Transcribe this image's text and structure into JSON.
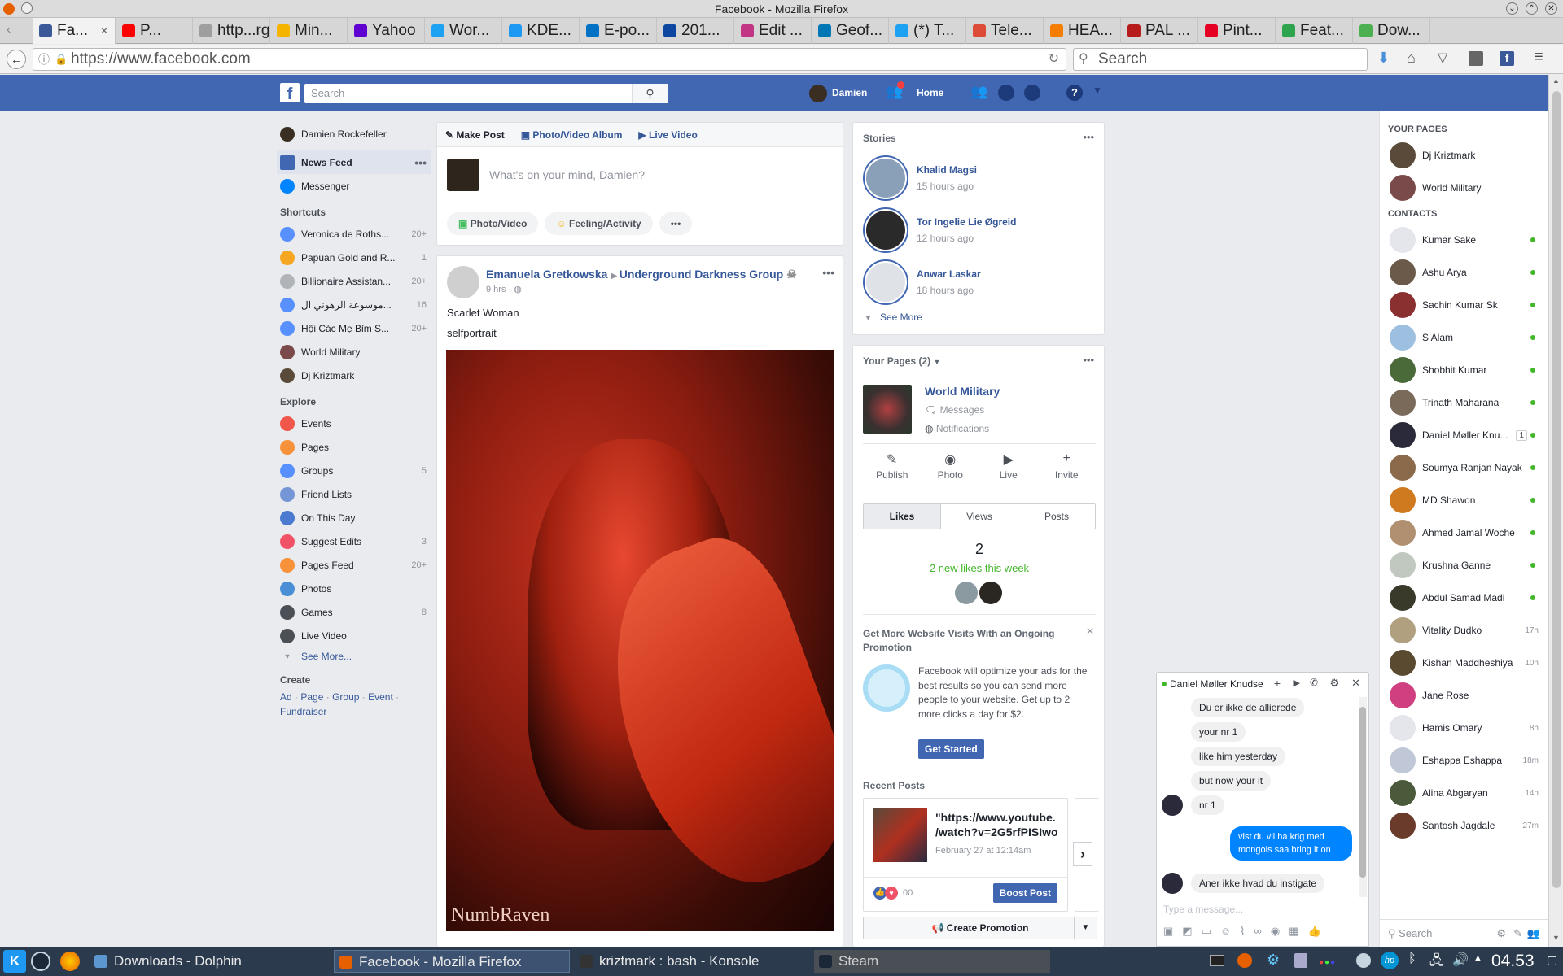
{
  "window": {
    "title": "Facebook - Mozilla Firefox"
  },
  "tabs": [
    {
      "label": "Fa...",
      "color": "#3b5998"
    },
    {
      "label": "P...",
      "color": "#ff0000"
    },
    {
      "label": "http...rg/",
      "color": "#9e9e9e"
    },
    {
      "label": "Min...",
      "color": "#f4b400"
    },
    {
      "label": "Yahoo",
      "color": "#5f01d1"
    },
    {
      "label": "Wor...",
      "color": "#1da1f2"
    },
    {
      "label": "KDE...",
      "color": "#1d99f3"
    },
    {
      "label": "E-po...",
      "color": "#0072c6"
    },
    {
      "label": "201...",
      "color": "#0d47a1"
    },
    {
      "label": "Edit ...",
      "color": "#c13584"
    },
    {
      "label": "Geof...",
      "color": "#0077b5"
    },
    {
      "label": "(*) T...",
      "color": "#1da1f2"
    },
    {
      "label": "Tele...",
      "color": "#dd4b39"
    },
    {
      "label": "HEA...",
      "color": "#f57d00"
    },
    {
      "label": "PAL ...",
      "color": "#b71c1c"
    },
    {
      "label": "Pint...",
      "color": "#e60023"
    },
    {
      "label": "Feat...",
      "color": "#2ea44f"
    },
    {
      "label": "Dow...",
      "color": "#4caf50"
    }
  ],
  "navbar": {
    "url": "https://www.facebook.com",
    "search_placeholder": "Search"
  },
  "fb_header": {
    "search_placeholder": "Search",
    "user_name": "Damien",
    "home_label": "Home"
  },
  "left_nav": {
    "profile_name": "Damien Rockefeller",
    "news_feed": "News Feed",
    "messenger": "Messenger",
    "shortcuts_heading": "Shortcuts",
    "shortcuts": [
      {
        "label": "Veronica de Roths...",
        "count": "20+",
        "color": "#5890ff"
      },
      {
        "label": "Papuan Gold and R...",
        "count": "1",
        "color": "#f5a623"
      },
      {
        "label": "Billionaire Assistan...",
        "count": "20+",
        "color": "#b0b3b8"
      },
      {
        "label": "موسوعة الرهوني ال...",
        "count": "16",
        "color": "#5890ff"
      },
      {
        "label": "Hội Các Mẹ Bỉm S...",
        "count": "20+",
        "color": "#5890ff"
      },
      {
        "label": "World Military",
        "count": "",
        "color": "#7a4a4a"
      },
      {
        "label": "Dj Kriztmark",
        "count": "",
        "color": "#5a4a3a"
      }
    ],
    "explore_heading": "Explore",
    "explore": [
      {
        "label": "Events",
        "count": "",
        "color": "#f0564a"
      },
      {
        "label": "Pages",
        "count": "",
        "color": "#f7923a"
      },
      {
        "label": "Groups",
        "count": "5",
        "color": "#5890ff"
      },
      {
        "label": "Friend Lists",
        "count": "",
        "color": "#7596d6"
      },
      {
        "label": "On This Day",
        "count": "",
        "color": "#4a7bd1"
      },
      {
        "label": "Suggest Edits",
        "count": "3",
        "color": "#f25268"
      },
      {
        "label": "Pages Feed",
        "count": "20+",
        "color": "#f7923a"
      },
      {
        "label": "Photos",
        "count": "",
        "color": "#4a8fd6"
      },
      {
        "label": "Games",
        "count": "8",
        "color": "#4b4f56"
      },
      {
        "label": "Live Video",
        "count": "",
        "color": "#4b4f56"
      }
    ],
    "see_more": "See More...",
    "create_heading": "Create",
    "create_links": [
      "Ad",
      "Page",
      "Group",
      "Event",
      "Fundraiser"
    ]
  },
  "composer": {
    "tabs": [
      "Make Post",
      "Photo/Video Album",
      "Live Video"
    ],
    "placeholder": "What's on your mind, Damien?",
    "actions": [
      "Photo/Video",
      "Feeling/Activity"
    ]
  },
  "post": {
    "author": "Emanuela Gretkowska",
    "group": "Underground Darkness Group",
    "time": "9 hrs",
    "line1": "Scarlet Woman",
    "line2": "selfportrait",
    "watermark": "NumbRaven"
  },
  "stories": {
    "heading": "Stories",
    "items": [
      {
        "name": "Khalid Magsi",
        "time": "15 hours ago",
        "color": "#8aa0b8"
      },
      {
        "name": "Tor Ingelie Lie Øgreid",
        "time": "12 hours ago",
        "color": "#2a2a2a"
      },
      {
        "name": "Anwar Laskar",
        "time": "18 hours ago",
        "color": "#dfe3e8"
      }
    ],
    "see_more": "See More"
  },
  "your_pages": {
    "heading": "Your Pages (2)",
    "page_name": "World Military",
    "messages": "Messages",
    "notifications": "Notifications",
    "actions": [
      "Publish",
      "Photo",
      "Live",
      "Invite"
    ],
    "stat_tabs": [
      "Likes",
      "Views",
      "Posts"
    ],
    "likes_count": "2",
    "likes_note": "2 new likes this week",
    "promo_title": "Get More Website Visits With an Ongoing Promotion",
    "promo_text": "Facebook will optimize your ads for the best results so you can send more people to your website. Get up to 2 more clicks a day for $2.",
    "get_started": "Get Started",
    "recent_posts": "Recent Posts",
    "recent_link": "\"https://www.youtube. /watch?v=2G5rfPISIwo",
    "recent_date": "February 27 at 12:14am",
    "reactions": "00",
    "boost": "Boost Post",
    "create_promotion": "Create Promotion"
  },
  "right_panel": {
    "your_pages_heading": "YOUR PAGES",
    "pages": [
      {
        "name": "Dj Kriztmark",
        "color": "#5a4a3a"
      },
      {
        "name": "World Military",
        "color": "#7a4a4a"
      }
    ],
    "contacts_heading": "CONTACTS",
    "contacts": [
      {
        "name": "Kumar Sake",
        "status": "online",
        "ago": "",
        "badge": "",
        "color": "#e4e6eb"
      },
      {
        "name": "Ashu Arya",
        "status": "online",
        "ago": "",
        "badge": "",
        "color": "#6b5a4a"
      },
      {
        "name": "Sachin Kumar Sk",
        "status": "online",
        "ago": "",
        "badge": "",
        "color": "#8a3030"
      },
      {
        "name": "S Alam",
        "status": "online",
        "ago": "",
        "badge": "",
        "color": "#9ec0e0"
      },
      {
        "name": "Shobhit Kumar",
        "status": "online",
        "ago": "",
        "badge": "",
        "color": "#4a6a3a"
      },
      {
        "name": "Trinath Maharana",
        "status": "online",
        "ago": "",
        "badge": "",
        "color": "#7a6a5a"
      },
      {
        "name": "Daniel Møller Knu...",
        "status": "online",
        "ago": "",
        "badge": "1",
        "color": "#2a2a3a"
      },
      {
        "name": "Soumya Ranjan Nayak",
        "status": "online",
        "ago": "",
        "badge": "",
        "color": "#8a6a4a"
      },
      {
        "name": "MD Shawon",
        "status": "online",
        "ago": "",
        "badge": "",
        "color": "#d07a20"
      },
      {
        "name": "Ahmed Jamal Woche",
        "status": "online",
        "ago": "",
        "badge": "",
        "color": "#b09070"
      },
      {
        "name": "Krushna Ganne",
        "status": "online",
        "ago": "",
        "badge": "",
        "color": "#c0c8c0"
      },
      {
        "name": "Abdul Samad Madi",
        "status": "online",
        "ago": "",
        "badge": "",
        "color": "#3a3a2a"
      },
      {
        "name": "Vitality Dudko",
        "status": "idle",
        "ago": "17h",
        "badge": "",
        "color": "#b0a080"
      },
      {
        "name": "Kishan Maddheshiya",
        "status": "idle",
        "ago": "10h",
        "badge": "",
        "color": "#5a4a30"
      },
      {
        "name": "Jane Rose",
        "status": "idle",
        "ago": "",
        "badge": "",
        "color": "#d04080"
      },
      {
        "name": "Hamis Omary",
        "status": "idle",
        "ago": "8h",
        "badge": "",
        "color": "#e4e6eb"
      },
      {
        "name": "Eshappa Eshappa",
        "status": "idle",
        "ago": "18m",
        "badge": "",
        "color": "#c0c8d8"
      },
      {
        "name": "Alina Abgaryan",
        "status": "idle",
        "ago": "14h",
        "badge": "",
        "color": "#4a5a3a"
      },
      {
        "name": "Santosh Jagdale",
        "status": "idle",
        "ago": "27m",
        "badge": "",
        "color": "#6a3a2a"
      }
    ],
    "search_placeholder": "Search"
  },
  "chat": {
    "name": "Daniel Møller Knudse",
    "messages": [
      {
        "from": "them",
        "text": "Du er ikke de allierede"
      },
      {
        "from": "them",
        "text": "your nr 1"
      },
      {
        "from": "them",
        "text": "like him yesterday"
      },
      {
        "from": "them",
        "text": "but now your it"
      },
      {
        "from": "them",
        "text": "nr 1"
      },
      {
        "from": "me",
        "text": "vist du vil ha krig med mongols saa bring it on"
      },
      {
        "from": "them",
        "text": "Aner ikke hvad du instigate"
      }
    ],
    "input_placeholder": "Type a message..."
  },
  "taskbar": {
    "items": [
      "Downloads - Dolphin",
      "Facebook - Mozilla Firefox",
      "kriztmark : bash - Konsole",
      "Steam"
    ],
    "clock": "04.53"
  },
  "colors": {
    "fb_blue": "#4267b2",
    "link_blue": "#365899",
    "online_green": "#42b72a",
    "chat_me": "#0084ff"
  }
}
